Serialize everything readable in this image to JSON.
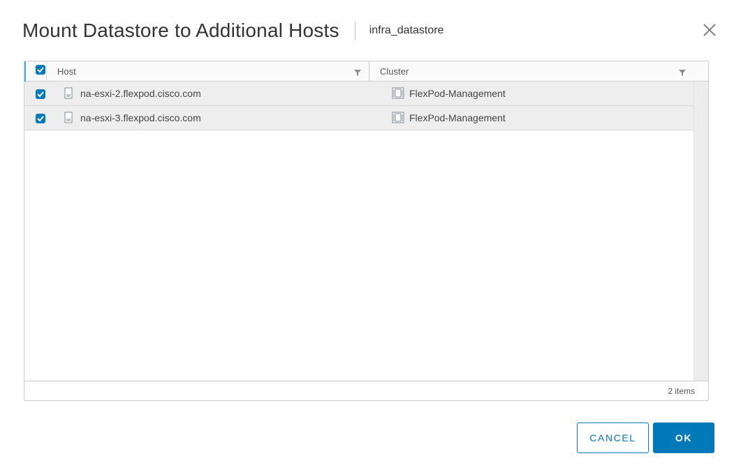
{
  "dialog": {
    "title": "Mount Datastore to Additional Hosts",
    "subtitle": "infra_datastore",
    "close_icon": "close-icon"
  },
  "grid": {
    "select_all_checked": true,
    "columns": [
      {
        "label": "Host",
        "filter_icon": "filter-icon"
      },
      {
        "label": "Cluster",
        "filter_icon": "filter-icon"
      }
    ],
    "rows": [
      {
        "selected": true,
        "host": "na-esxi-2.flexpod.cisco.com",
        "host_icon": "host-server-icon",
        "cluster": "FlexPod-Management",
        "cluster_icon": "cluster-icon"
      },
      {
        "selected": true,
        "host": "na-esxi-3.flexpod.cisco.com",
        "host_icon": "host-server-icon",
        "cluster": "FlexPod-Management",
        "cluster_icon": "cluster-icon"
      }
    ],
    "footer": {
      "items_count": "2 items"
    }
  },
  "buttons": {
    "cancel": "CANCEL",
    "ok": "OK"
  },
  "colors": {
    "accent": "#0079b8",
    "row_background": "#eeeeee",
    "header_background": "#fafafa",
    "border": "#cccccc"
  }
}
